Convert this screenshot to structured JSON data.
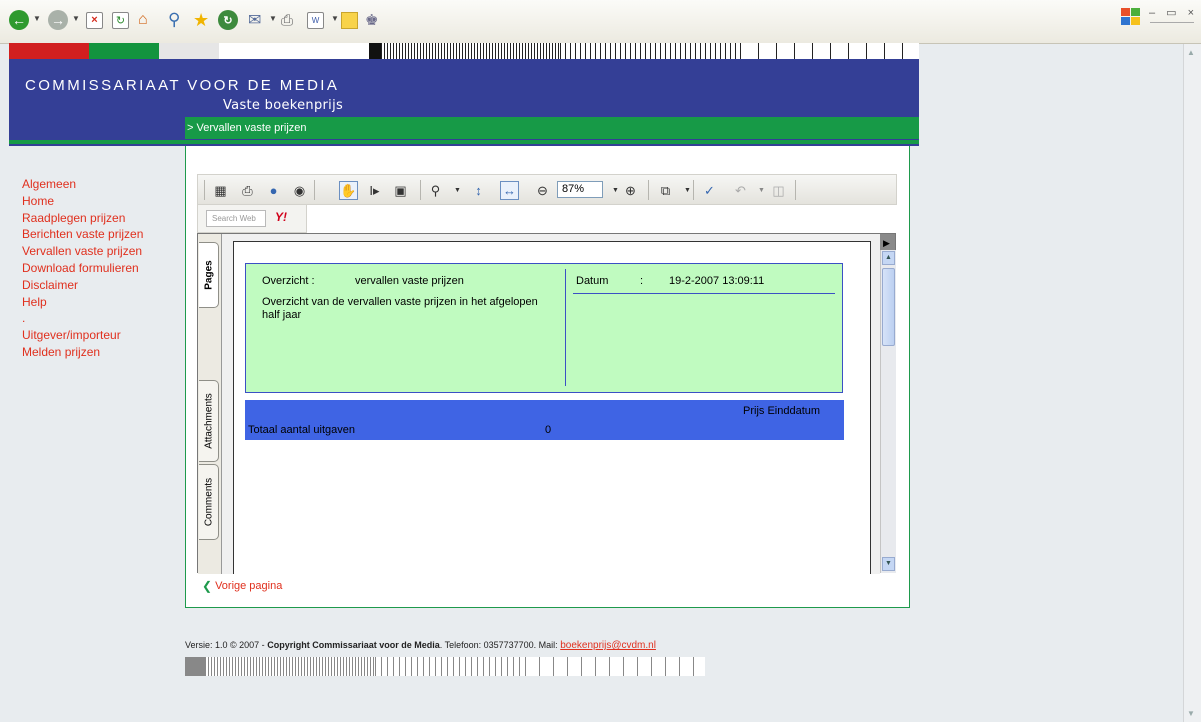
{
  "header": {
    "org_title": "COMMISSARIAAT VOOR DE MEDIA",
    "org_subtitle": "Vaste boekenprijs",
    "breadcrumb": "> Vervallen vaste prijzen"
  },
  "sidebar": {
    "items": [
      {
        "label": "Algemeen"
      },
      {
        "label": "Home"
      },
      {
        "label": "Raadplegen prijzen"
      },
      {
        "label": "Berichten vaste prijzen"
      },
      {
        "label": "Vervallen vaste prijzen"
      },
      {
        "label": "Download formulieren"
      },
      {
        "label": "Disclaimer"
      },
      {
        "label": "Help"
      }
    ],
    "separator": ".",
    "sub_items": [
      {
        "label": "Uitgever/importeur"
      },
      {
        "label": "Melden prijzen"
      }
    ]
  },
  "reader": {
    "zoom": "87%",
    "search_placeholder": "Search Web",
    "yahoo_label": "Y!",
    "tabs": {
      "pages": "Pages",
      "attachments": "Attachments",
      "comments": "Comments"
    }
  },
  "report": {
    "overzicht_label": "Overzicht :",
    "overzicht_value": "vervallen vaste prijzen",
    "description": "Overzicht van de vervallen vaste prijzen in het afgelopen half jaar",
    "datum_label": "Datum",
    "datum_colon": ":",
    "datum_value": "19-2-2007 13:09:11",
    "columns_header": "Prijs Einddatum",
    "total_label": "Totaal aantal uitgaven",
    "total_value": "0"
  },
  "back_link": "Vorige pagina",
  "footer": {
    "version": "Versie: 1.0 © 2007 -",
    "copyright": "Copyright Commissariaat voor de Media",
    "phone": ". Telefoon: 0357737700.  Mail:",
    "mail": "boekenprijs@cvdm.nl"
  },
  "colors": {
    "header_blue": "#343f96",
    "accent_green": "#179a47",
    "link_red": "#e0301e",
    "report_green": "#c0fbc0",
    "report_blue": "#3f64e4"
  }
}
